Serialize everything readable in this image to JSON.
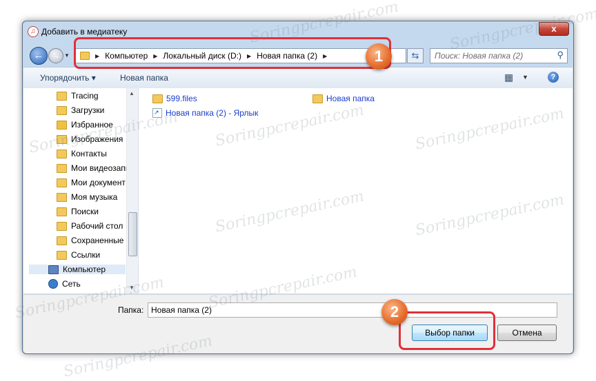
{
  "window": {
    "title": "Добавить в медиатеку",
    "close_label": "x"
  },
  "address_bar": {
    "crumbs": [
      "Компьютер",
      "Локальный диск (D:)",
      "Новая папка (2)"
    ]
  },
  "search": {
    "placeholder": "Поиск: Новая папка (2)"
  },
  "toolbar": {
    "organize_label": "Упорядочить ▾",
    "new_folder_label": "Новая папка"
  },
  "nav_pane": {
    "items": [
      {
        "label": "Tracing",
        "icon": "folder-icon"
      },
      {
        "label": "Загрузки",
        "icon": "folder-icon"
      },
      {
        "label": "Избранное",
        "icon": "favorites-folder-icon"
      },
      {
        "label": "Изображения",
        "icon": "folder-icon"
      },
      {
        "label": "Контакты",
        "icon": "folder-icon"
      },
      {
        "label": "Мои видеозапи",
        "icon": "folder-icon"
      },
      {
        "label": "Мои документ",
        "icon": "folder-icon"
      },
      {
        "label": "Моя музыка",
        "icon": "folder-icon"
      },
      {
        "label": "Поиски",
        "icon": "folder-icon"
      },
      {
        "label": "Рабочий стол",
        "icon": "folder-icon"
      },
      {
        "label": "Сохраненные и",
        "icon": "folder-icon"
      },
      {
        "label": "Ссылки",
        "icon": "folder-icon"
      },
      {
        "label": "Компьютер",
        "icon": "computer-icon"
      },
      {
        "label": "Сеть",
        "icon": "network-icon"
      }
    ]
  },
  "files": [
    {
      "name": "599.files",
      "icon": "folder-icon"
    },
    {
      "name": "Новая папка",
      "icon": "folder-icon"
    },
    {
      "name": "Новая папка (2) - Ярлык",
      "icon": "shortcut-icon"
    }
  ],
  "bottom": {
    "folder_label": "Папка:",
    "folder_value": "Новая папка (2)",
    "select_button": "Выбор папки",
    "cancel_button": "Отмена"
  },
  "callouts": [
    "1",
    "2"
  ],
  "watermark": "Soringpcrepair.com",
  "colors": {
    "highlight": "#e0303a",
    "badge": "#e56a2a",
    "link_text": "#1a3ccd"
  }
}
